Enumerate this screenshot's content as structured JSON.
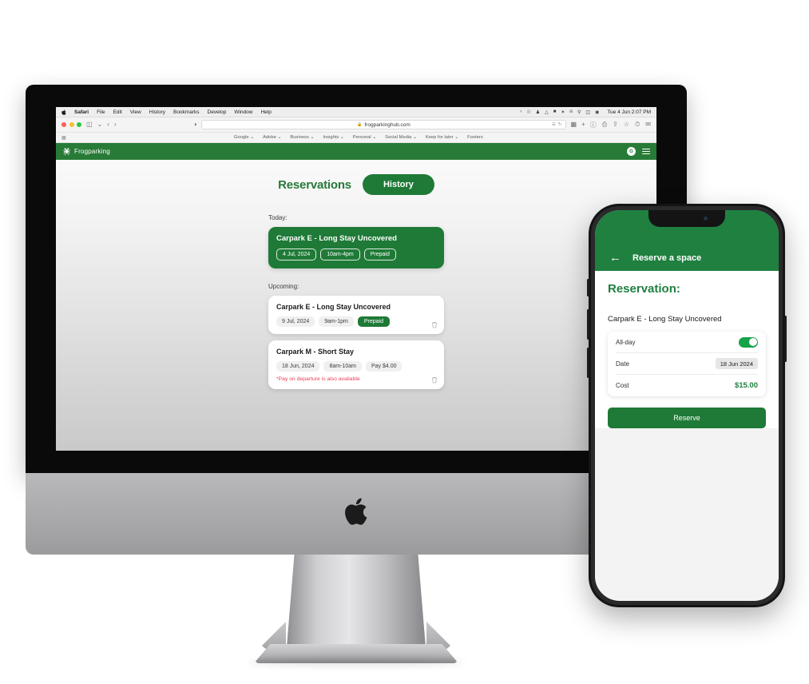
{
  "os_menubar": {
    "apple_icon": "apple-icon",
    "items": [
      "Safari",
      "File",
      "Edit",
      "View",
      "History",
      "Bookmarks",
      "Develop",
      "Window",
      "Help"
    ],
    "status_icons": [
      "chevron-left-icon",
      "shield-icon",
      "headphones-icon",
      "airplay-icon",
      "battery-icon",
      "bluetooth-icon",
      "wifi-icon",
      "search-icon",
      "control-center-icon",
      "siri-icon"
    ],
    "clock": "Tue 4 Jun 2:07 PM"
  },
  "safari_toolbar": {
    "traffic_lights": [
      "close-red",
      "minimize-yellow",
      "zoom-green"
    ],
    "sidebar_icon": "sidebar-icon",
    "sidebar_chevron": "chevron-down-icon",
    "back_icon": "chevron-left-icon",
    "forward_icon": "chevron-right-icon",
    "shield_icon": "privacy-shield-icon",
    "url": "frogparkinghub.com",
    "lock_icon": "lock-icon",
    "reader_icon": "reader-icon",
    "refresh_icon": "refresh-icon",
    "tab_overview_icon": "tab-overview-icon",
    "new_tab_icon": "plus-icon",
    "right_icons": [
      "downloads-icon",
      "print-icon",
      "share-icon",
      "bookmark-star-icon",
      "history-clock-icon",
      "mail-icon"
    ]
  },
  "bookmarks_bar": {
    "sidebar_icon": "grid-icon",
    "items": [
      "Google",
      "Adobe",
      "Business",
      "Insights",
      "Personal",
      "Social Media",
      "Keep for later",
      "Footers"
    ]
  },
  "app": {
    "brand": "Frogparking",
    "brand_icon": "frog-logo-icon",
    "avatar_initial": "G",
    "menu_icon": "hamburger-menu-icon",
    "tab_reservations": "Reservations",
    "btn_history": "History",
    "section_today": "Today:",
    "section_upcoming": "Upcoming:",
    "today_card": {
      "title": "Carpark E - Long Stay Uncovered",
      "chips": [
        "4 Jul, 2024",
        "10am-4pm",
        "Prepaid"
      ]
    },
    "upcoming_cards": [
      {
        "title": "Carpark E - Long Stay Uncovered",
        "date": "9 Jul, 2024",
        "time": "9am-1pm",
        "status": "Prepaid",
        "note": "",
        "delete_icon": "trash-icon"
      },
      {
        "title": "Carpark M - Short Stay",
        "date": "18 Jun, 2024",
        "time": "8am-10am",
        "status": "Pay $4.00",
        "note": "*Pay on departure is also available",
        "delete_icon": "trash-icon"
      }
    ]
  },
  "phone": {
    "back_icon": "arrow-left-icon",
    "nav_title": "Reserve a space",
    "heading": "Reservation:",
    "carpark": "Carpark E - Long Stay Uncovered",
    "rows": [
      {
        "label": "All-day",
        "value": "",
        "type": "toggle",
        "toggle_on": true
      },
      {
        "label": "Date",
        "value": "18 Jun 2024",
        "type": "pill"
      },
      {
        "label": "Cost",
        "value": "$15.00",
        "type": "cost"
      }
    ],
    "reserve_button": "Reserve"
  },
  "colors": {
    "brand_green": "#277b37",
    "accent_green": "#1f7a37",
    "phone_green": "#1f8040",
    "toggle_green": "#16a34a",
    "alert_red": "#ef3b5b"
  },
  "device": {
    "imac_logo": "apple-logo-icon"
  }
}
